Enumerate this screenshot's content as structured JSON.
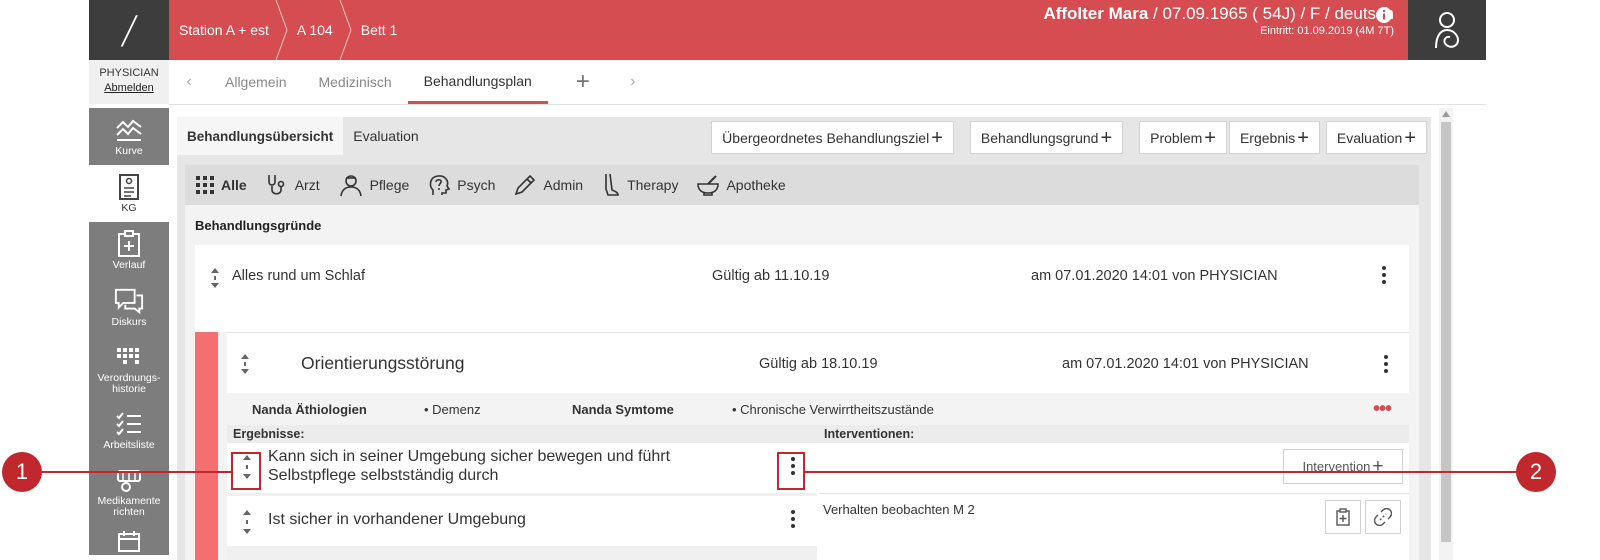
{
  "role": {
    "label": "PHYSICIAN",
    "logout": "Abmelden"
  },
  "nav": [
    {
      "label": "Kurve",
      "icon": "chart-wave-icon"
    },
    {
      "label": "KG",
      "icon": "document-icon"
    },
    {
      "label": "Verlauf",
      "icon": "clipboard-plus-icon"
    },
    {
      "label": "Diskurs",
      "icon": "chat-bubbles-icon"
    },
    {
      "label": "Verordnungs-historie",
      "icon": "grid-bars-icon"
    },
    {
      "label": "Arbeitsliste",
      "icon": "checklist-icon"
    },
    {
      "label": "Medikamente richten",
      "icon": "pills-icon"
    }
  ],
  "breadcrumbs": [
    "Station A + est",
    "A 104",
    "Bett 1"
  ],
  "patient": {
    "name": "Affolter Mara",
    "details": " / 07.09.1965 ( 54J) / F / deutsch",
    "entry": "Eintritt: 01.09.2019 (4M 7T)"
  },
  "tabs": [
    "Allgemein",
    "Medizinisch",
    "Behandlungsplan"
  ],
  "active_tab": "Behandlungsplan",
  "subtabs": [
    "Behandlungsübersicht",
    "Evaluation"
  ],
  "actions": [
    "Übergeordnetes Behandlungsziel",
    "Behandlungsgrund",
    "Problem",
    "Ergebnis",
    "Evaluation"
  ],
  "filters": [
    "Alle",
    "Arzt",
    "Pflege",
    "Psych",
    "Admin",
    "Therapy",
    "Apotheke"
  ],
  "section_title": "Behandlungsgründe",
  "reason": {
    "title": "Alles rund um Schlaf",
    "valid": "Gültig ab 11.10.19",
    "meta": "am 07.01.2020 14:01 von PHYSICIAN"
  },
  "problem": {
    "title": "Orientierungsstörung",
    "valid": "Gültig ab 18.10.19",
    "meta": "am 07.01.2020 14:01 von PHYSICIAN",
    "nanda_label_1": "Nanda Äthiologien",
    "nanda_value_1": "Demenz",
    "nanda_label_2": "Nanda Symtome",
    "nanda_value_2": "Chronische Verwirrtheitszustände",
    "col_results": "Ergebnisse:",
    "col_interventions": "Interventionen:",
    "results": [
      "Kann sich in seiner Umgebung sicher bewegen und führt Selbstpflege selbstständig durch",
      "Ist sicher in vorhandener Umgebung"
    ],
    "intervention_button": "Intervention",
    "intervention_item": "Verhalten beobachten M 2"
  },
  "callouts": [
    "1",
    "2"
  ],
  "colors": {
    "header": "#d64d51",
    "callout": "#c0282e",
    "strip": "#f47070",
    "sidebar": "#7d7d7d"
  }
}
